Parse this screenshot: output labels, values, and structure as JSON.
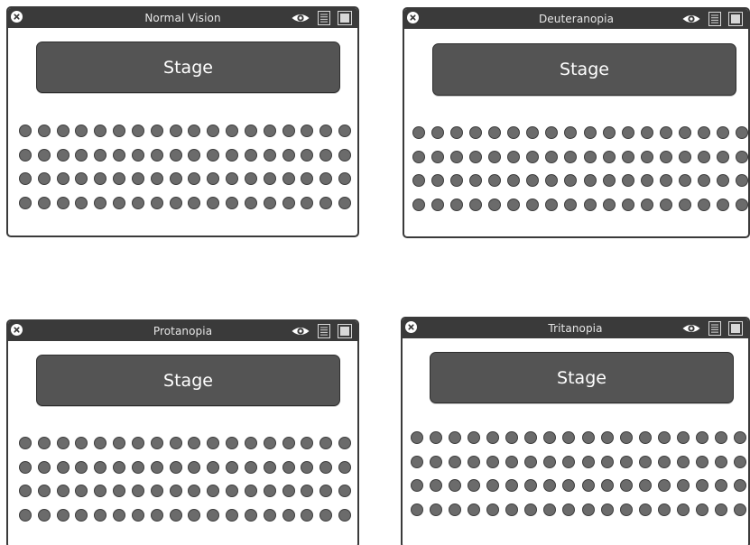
{
  "panels": [
    {
      "id": "normal",
      "title": "Normal Vision",
      "stage_label": "Stage"
    },
    {
      "id": "deuteranopia",
      "title": "Deuteranopia",
      "stage_label": "Stage"
    },
    {
      "id": "protanopia",
      "title": "Protanopia",
      "stage_label": "Stage"
    },
    {
      "id": "tritanopia",
      "title": "Tritanopia",
      "stage_label": "Stage"
    }
  ],
  "seating": {
    "rows": 4,
    "seats_per_row": 18
  },
  "icons": {
    "close": "close-icon",
    "view": "eye-icon",
    "list": "list-icon",
    "square": "square-icon"
  },
  "colors": {
    "titlebar": "#3a3a3a",
    "stage": "#545454",
    "seat": "#6b6b6b"
  }
}
